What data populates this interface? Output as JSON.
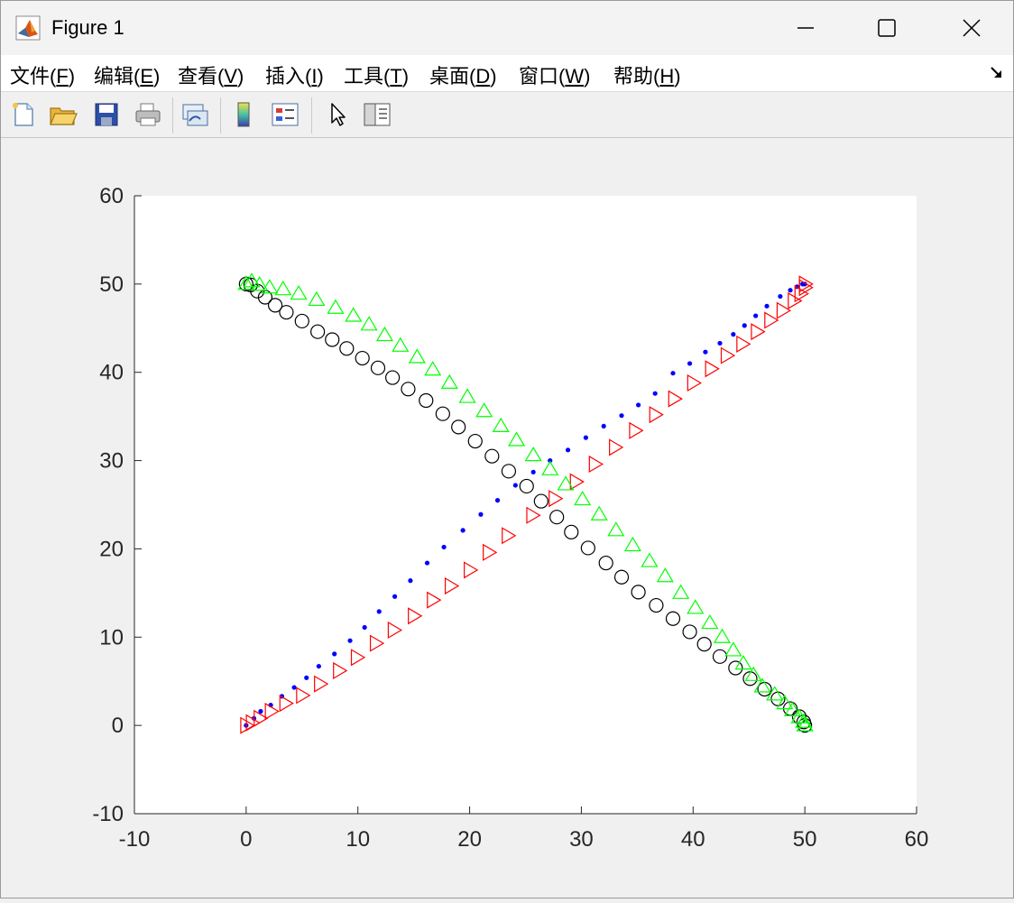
{
  "window": {
    "title": "Figure 1",
    "menus": [
      {
        "text": "文件(",
        "key": "F",
        "end": ")"
      },
      {
        "text": "编辑(",
        "key": "E",
        "end": ")"
      },
      {
        "text": "查看(",
        "key": "V",
        "end": ")"
      },
      {
        "text": "插入(",
        "key": "I",
        "end": ")"
      },
      {
        "text": "工具(",
        "key": "T",
        "end": ")"
      },
      {
        "text": "桌面(",
        "key": "D",
        "end": ")"
      },
      {
        "text": "窗口(",
        "key": "W",
        "end": ")"
      },
      {
        "text": "帮助(",
        "key": "H",
        "end": ")"
      }
    ],
    "toolbar_icons": [
      "new-figure-icon",
      "open-file-icon",
      "save-icon",
      "print-icon",
      "link-plot-icon",
      "colorbar-icon",
      "legend-icon",
      "pointer-icon",
      "property-inspector-icon"
    ]
  },
  "chart_data": {
    "type": "scatter",
    "title": "",
    "xlabel": "",
    "ylabel": "",
    "xlim": [
      -10,
      60
    ],
    "ylim": [
      -10,
      60
    ],
    "xticks": [
      "-10",
      "0",
      "10",
      "20",
      "30",
      "40",
      "50",
      "60"
    ],
    "yticks": [
      "-10",
      "0",
      "10",
      "20",
      "30",
      "40",
      "50",
      "60"
    ],
    "grid": false,
    "series": [
      {
        "marker": "dot",
        "color": "#0000ff",
        "points": [
          [
            0,
            0
          ],
          [
            0.7,
            0.8
          ],
          [
            1.3,
            1.6
          ],
          [
            2.2,
            2.3
          ],
          [
            3.2,
            3.3
          ],
          [
            4.3,
            4.3
          ],
          [
            5.4,
            5.4
          ],
          [
            6.5,
            6.7
          ],
          [
            7.9,
            8.1
          ],
          [
            9.3,
            9.6
          ],
          [
            10.6,
            11.1
          ],
          [
            11.9,
            12.9
          ],
          [
            13.3,
            14.6
          ],
          [
            14.7,
            16.4
          ],
          [
            16.2,
            18.4
          ],
          [
            17.7,
            20.2
          ],
          [
            19.4,
            22.1
          ],
          [
            21.0,
            23.9
          ],
          [
            22.5,
            25.5
          ],
          [
            24.1,
            27.2
          ],
          [
            25.7,
            28.7
          ],
          [
            27.2,
            30.0
          ],
          [
            28.8,
            31.2
          ],
          [
            30.4,
            32.6
          ],
          [
            32.0,
            33.9
          ],
          [
            33.6,
            35.1
          ],
          [
            35.1,
            36.3
          ],
          [
            36.6,
            37.6
          ],
          [
            38.2,
            39.9
          ],
          [
            39.7,
            41.0
          ],
          [
            41.1,
            42.3
          ],
          [
            42.4,
            43.3
          ],
          [
            43.6,
            44.3
          ],
          [
            44.6,
            45.3
          ],
          [
            45.6,
            46.4
          ],
          [
            46.6,
            47.5
          ],
          [
            47.8,
            48.6
          ],
          [
            48.7,
            49.3
          ],
          [
            49.3,
            49.7
          ],
          [
            49.8,
            50.0
          ],
          [
            50,
            50
          ]
        ]
      },
      {
        "marker": "triangle-right",
        "color": "#ff0000",
        "points": [
          [
            0,
            0
          ],
          [
            0.5,
            0.3
          ],
          [
            1.2,
            0.8
          ],
          [
            2.2,
            1.6
          ],
          [
            3.5,
            2.5
          ],
          [
            5.0,
            3.4
          ],
          [
            6.6,
            4.7
          ],
          [
            8.3,
            6.2
          ],
          [
            9.9,
            7.7
          ],
          [
            11.6,
            9.3
          ],
          [
            13.2,
            10.8
          ],
          [
            15.0,
            12.4
          ],
          [
            16.7,
            14.2
          ],
          [
            18.3,
            15.8
          ],
          [
            20.0,
            17.6
          ],
          [
            21.7,
            19.6
          ],
          [
            23.4,
            21.5
          ],
          [
            25.6,
            23.8
          ],
          [
            27.6,
            25.7
          ],
          [
            29.5,
            27.6
          ],
          [
            31.2,
            29.6
          ],
          [
            33.0,
            31.5
          ],
          [
            34.8,
            33.4
          ],
          [
            36.6,
            35.2
          ],
          [
            38.3,
            37.0
          ],
          [
            40.0,
            38.8
          ],
          [
            41.6,
            40.4
          ],
          [
            43.0,
            41.9
          ],
          [
            44.4,
            43.2
          ],
          [
            45.7,
            44.6
          ],
          [
            46.9,
            45.9
          ],
          [
            48.0,
            47.0
          ],
          [
            49.0,
            48.1
          ],
          [
            49.6,
            48.9
          ],
          [
            50.0,
            49.6
          ],
          [
            50,
            50
          ]
        ]
      },
      {
        "marker": "circle",
        "color": "#000000",
        "points": [
          [
            0,
            50
          ],
          [
            0.4,
            49.9
          ],
          [
            1.0,
            49.2
          ],
          [
            1.7,
            48.5
          ],
          [
            2.6,
            47.6
          ],
          [
            3.6,
            46.8
          ],
          [
            5.0,
            45.8
          ],
          [
            6.4,
            44.6
          ],
          [
            7.7,
            43.7
          ],
          [
            9.0,
            42.7
          ],
          [
            10.4,
            41.6
          ],
          [
            11.8,
            40.5
          ],
          [
            13.1,
            39.4
          ],
          [
            14.5,
            38.1
          ],
          [
            16.1,
            36.8
          ],
          [
            17.6,
            35.3
          ],
          [
            19.0,
            33.8
          ],
          [
            20.5,
            32.2
          ],
          [
            22.0,
            30.5
          ],
          [
            23.5,
            28.8
          ],
          [
            25.1,
            27.1
          ],
          [
            26.4,
            25.4
          ],
          [
            27.8,
            23.6
          ],
          [
            29.1,
            21.9
          ],
          [
            30.6,
            20.1
          ],
          [
            32.2,
            18.4
          ],
          [
            33.6,
            16.8
          ],
          [
            35.1,
            15.1
          ],
          [
            36.7,
            13.6
          ],
          [
            38.2,
            12.1
          ],
          [
            39.7,
            10.6
          ],
          [
            41.0,
            9.2
          ],
          [
            42.4,
            7.8
          ],
          [
            43.8,
            6.5
          ],
          [
            45.1,
            5.3
          ],
          [
            46.4,
            4.1
          ],
          [
            47.6,
            3.0
          ],
          [
            48.7,
            1.9
          ],
          [
            49.5,
            1.0
          ],
          [
            49.9,
            0.4
          ],
          [
            50,
            0
          ]
        ]
      },
      {
        "marker": "triangle-up",
        "color": "#00ff00",
        "points": [
          [
            0,
            50
          ],
          [
            0.5,
            50.3
          ],
          [
            1.2,
            49.9
          ],
          [
            2.1,
            49.6
          ],
          [
            3.3,
            49.4
          ],
          [
            4.7,
            48.9
          ],
          [
            6.3,
            48.2
          ],
          [
            8.0,
            47.3
          ],
          [
            9.6,
            46.4
          ],
          [
            11.0,
            45.4
          ],
          [
            12.4,
            44.2
          ],
          [
            13.8,
            43.0
          ],
          [
            15.3,
            41.7
          ],
          [
            16.7,
            40.3
          ],
          [
            18.2,
            38.8
          ],
          [
            19.8,
            37.2
          ],
          [
            21.3,
            35.6
          ],
          [
            22.8,
            33.9
          ],
          [
            24.2,
            32.3
          ],
          [
            25.7,
            30.6
          ],
          [
            27.2,
            29.0
          ],
          [
            28.6,
            27.3
          ],
          [
            30.1,
            25.6
          ],
          [
            31.6,
            23.9
          ],
          [
            33.1,
            22.1
          ],
          [
            34.6,
            20.4
          ],
          [
            36.1,
            18.6
          ],
          [
            37.5,
            16.9
          ],
          [
            38.9,
            15.0
          ],
          [
            40.2,
            13.3
          ],
          [
            41.5,
            11.6
          ],
          [
            42.6,
            10.0
          ],
          [
            43.6,
            8.5
          ],
          [
            44.5,
            7.0
          ],
          [
            45.4,
            5.7
          ],
          [
            46.2,
            4.4
          ],
          [
            47.3,
            3.5
          ],
          [
            48.2,
            2.5
          ],
          [
            48.9,
            1.7
          ],
          [
            49.5,
            0.9
          ],
          [
            49.9,
            0.4
          ],
          [
            50,
            0
          ]
        ]
      }
    ]
  }
}
